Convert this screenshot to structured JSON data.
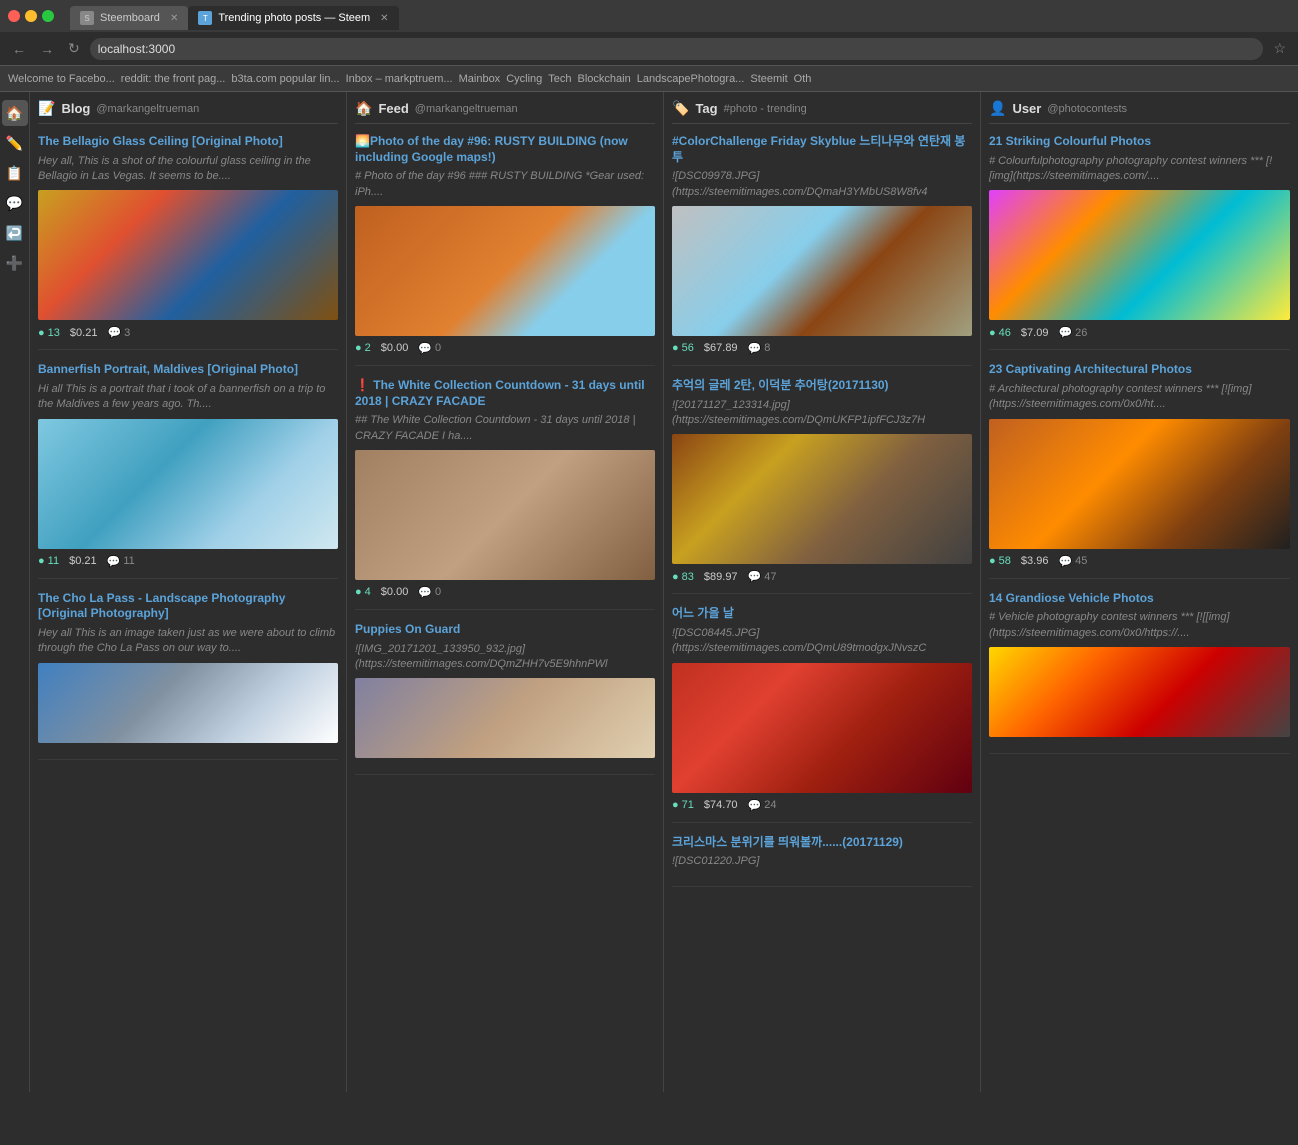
{
  "browser": {
    "tabs": [
      {
        "label": "Steemboard",
        "active": false,
        "favicon": "S"
      },
      {
        "label": "Trending photo posts — Steem",
        "active": true,
        "favicon": "T"
      }
    ],
    "address": "localhost:3000",
    "bookmarks": [
      "Welcome to Facebo...",
      "reddit: the front pag...",
      "b3ta.com popular lin...",
      "Inbox – markptruem...",
      "Mainbox",
      "Cycling",
      "Tech",
      "Blockchain",
      "LandscapePhotogra...",
      "Steemit",
      "Oth"
    ]
  },
  "sidebar": {
    "icons": [
      "🏠",
      "✏️",
      "📋",
      "💬",
      "↩️",
      "➕"
    ]
  },
  "columns": [
    {
      "id": "blog",
      "icon": "📝",
      "title": "Blog",
      "username": "@markangeltrueman",
      "posts": [
        {
          "title": "The Bellagio Glass Ceiling [Original Photo]",
          "excerpt": "Hey all, This is a shot of the colourful glass ceiling in the Bellagio in Las Vegas. It seems to be....",
          "image": "bellagio",
          "votes": 13,
          "value": "$0.21",
          "comments": 3
        },
        {
          "title": "Bannerfish Portrait, Maldives [Original Photo]",
          "excerpt": "Hi all This is a portrait that i took of a bannerfish on a trip to the Maldives a few years ago. Th....",
          "image": "bannerfish",
          "votes": 11,
          "value": "$0.21",
          "comments": 11
        },
        {
          "title": "The Cho La Pass - Landscape Photography [Original Photography]",
          "excerpt": "Hey all This is an image taken just as we were about to climb through the Cho La Pass on our way to....",
          "image": "chola",
          "votes": null,
          "value": null,
          "comments": null
        }
      ]
    },
    {
      "id": "feed",
      "icon": "🏠",
      "title": "Feed",
      "username": "@markangeltrueman",
      "posts": [
        {
          "title": "🌅Photo of the day #96: RUSTY BUILDING (now including Google maps!)",
          "excerpt": "# Photo of the day #96 ### RUSTY BUILDING *Gear used: iPh....",
          "image": "rusty",
          "votes": 2,
          "value": "$0.00",
          "comments": 0
        },
        {
          "title": "❗ The White Collection Countdown - 31 days until 2018 | CRAZY FACADE",
          "excerpt": "## The White Collection Countdown - 31 days until 2018 | CRAZY FACADE I ha....",
          "image": "white-col",
          "votes": 4,
          "value": "$0.00",
          "comments": 0
        },
        {
          "title": "Puppies On Guard",
          "excerpt": "![IMG_20171201_133950_932.jpg](https://steemitimages.com/DQmZHH7v5E9hhnPWl",
          "image": "puppies",
          "votes": null,
          "value": null,
          "comments": null
        }
      ]
    },
    {
      "id": "tag",
      "icon": "🏷️",
      "title": "Tag",
      "hashtag": "#photo - trending",
      "posts": [
        {
          "title": "#ColorChallenge Friday Skyblue 느티나무와 연탄재 봉투",
          "excerpt": "![DSC09978.JPG](https://steemitimages.com/DQmaH3YMbUS8W8fv4",
          "image": "tag1",
          "votes": 56,
          "value": "$67.89",
          "comments": 8
        },
        {
          "title": "추억의 글레 2탄, 이덕분 추어탕(20171130)",
          "excerpt": "![20171127_123314.jpg](https://steemitimages.com/DQmUKFP1ipfFCJ3z7H",
          "image": "tag2",
          "votes": 83,
          "value": "$89.97",
          "comments": 47
        },
        {
          "title": "어느 가을 날",
          "excerpt": "![DSC08445.JPG](https://steemitimages.com/DQmU89tmodgxJNvszC",
          "image": "tag3",
          "votes": 71,
          "value": "$74.70",
          "comments": 24
        },
        {
          "title": "크리스마스 분위기를 띄워볼까......(20171129)",
          "excerpt": "![DSC01220.JPG]",
          "image": "tag3",
          "votes": null,
          "value": null,
          "comments": null
        }
      ]
    },
    {
      "id": "user",
      "icon": "👤",
      "title": "User",
      "username": "@photocontests",
      "posts": [
        {
          "title": "21 Striking Colourful Photos",
          "excerpt": "# Colourfulphotography photography contest winners *** [![img](https://steemitimages.com/....",
          "image": "colourful",
          "votes": 46,
          "value": "$7.09",
          "comments": 26
        },
        {
          "title": "23 Captivating Architectural Photos",
          "excerpt": "# Architectural photography contest winners *** [![img](https://steemitimages.com/0x0/ht....",
          "image": "bridge",
          "votes": 58,
          "value": "$3.96",
          "comments": 45
        },
        {
          "title": "14 Grandiose Vehicle Photos",
          "excerpt": "# Vehicle photography contest winners *** [![[img](https://steemitimages.com/0x0/https://....",
          "image": "vehicle",
          "votes": null,
          "value": null,
          "comments": null
        }
      ]
    }
  ]
}
